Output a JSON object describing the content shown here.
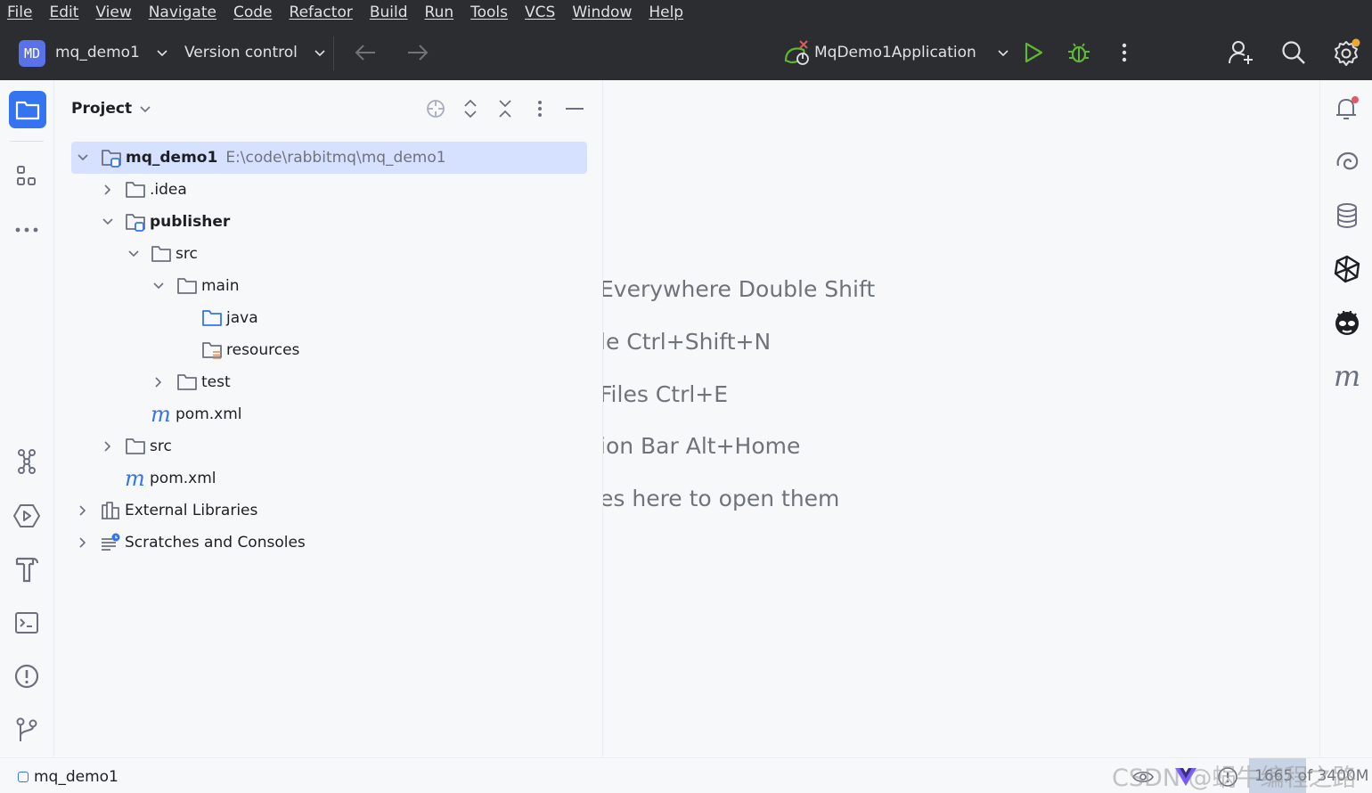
{
  "menu": [
    "File",
    "Edit",
    "View",
    "Navigate",
    "Code",
    "Refactor",
    "Build",
    "Run",
    "Tools",
    "VCS",
    "Window",
    "Help"
  ],
  "toolbar": {
    "project_badge": "MD",
    "project_name": "mq_demo1",
    "vcs_label": "Version control",
    "run_config": "MqDemo1Application"
  },
  "project_panel": {
    "title": "Project",
    "tree": [
      {
        "label": "mq_demo1",
        "path": "E:\\code\\rabbitmq\\mq_demo1"
      },
      {
        "label": ".idea"
      },
      {
        "label": "publisher"
      },
      {
        "label": "src"
      },
      {
        "label": "main"
      },
      {
        "label": "java"
      },
      {
        "label": "resources"
      },
      {
        "label": "test"
      },
      {
        "label": "pom.xml"
      },
      {
        "label": "src"
      },
      {
        "label": "pom.xml"
      },
      {
        "label": "External Libraries"
      },
      {
        "label": "Scratches and Consoles"
      }
    ]
  },
  "editor": {
    "hints": [
      "Everywhere Double Shift",
      "le Ctrl+Shift+N",
      "Files Ctrl+E",
      "ion Bar Alt+Home",
      "es here to open them"
    ]
  },
  "status": {
    "breadcrumb": "mq_demo1",
    "memory": "1665 of 3400M",
    "watermark": "CSDN @蜗牛编程之路"
  },
  "colors": {
    "toolbar_bg": "#2b2d30",
    "selection": "#d5e1ff",
    "accent_blue": "#3574f0",
    "run_green": "#5fb832"
  }
}
